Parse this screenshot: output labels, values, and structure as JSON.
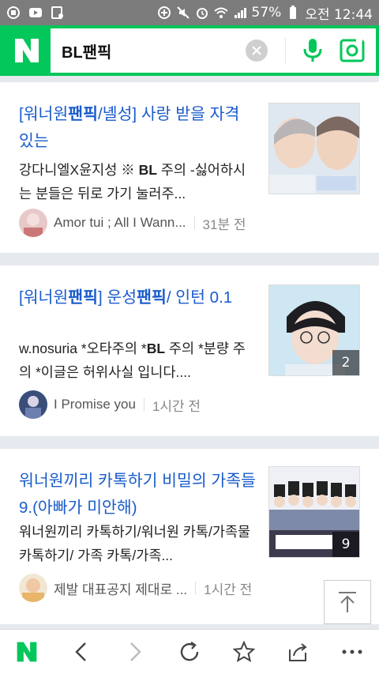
{
  "status_bar": {
    "battery": "57%",
    "time": "오전 12:44"
  },
  "search": {
    "query": "BL팬픽",
    "logo": "N"
  },
  "results": [
    {
      "title_parts": [
        {
          "text": "[워너원",
          "bold": false
        },
        {
          "text": "팬픽",
          "bold": true
        },
        {
          "text": "/녤성] 사랑 받을 자격 있는",
          "bold": false
        }
      ],
      "desc_parts": [
        {
          "text": "강다니엘X윤지성 ※ ",
          "bold": false
        },
        {
          "text": "BL",
          "bold": true
        },
        {
          "text": " 주의 -싫어하시는 분들은 뒤로 가기 눌러주...",
          "bold": false
        }
      ],
      "author": "Amor tui ; All I Wann...",
      "time": "31분 전",
      "image_count": ""
    },
    {
      "title_parts": [
        {
          "text": "[워너원",
          "bold": false
        },
        {
          "text": "팬픽",
          "bold": true
        },
        {
          "text": "] 운성",
          "bold": false
        },
        {
          "text": "팬픽",
          "bold": true
        },
        {
          "text": "/ 인턴 0.1",
          "bold": false
        }
      ],
      "desc_parts": [
        {
          "text": "w.nosuria *오타주의 *",
          "bold": false
        },
        {
          "text": "BL",
          "bold": true
        },
        {
          "text": " 주의 *분량 주의 *이글은 허위사실 입니다....",
          "bold": false
        }
      ],
      "author": "I Promise you",
      "time": "1시간 전",
      "image_count": "2"
    },
    {
      "title_parts": [
        {
          "text": "워너원끼리 카톡하기 비밀의 가족들 9.(아빠가 미안해)",
          "bold": false
        }
      ],
      "desc_parts": [
        {
          "text": "워너원끼리 카톡하기/워너원 카톡/가족물 카톡하기/ 가족 카톡/가족...",
          "bold": false
        }
      ],
      "author": "제발 대표공지 제대로 ...",
      "time": "1시간 전",
      "image_count": "9"
    }
  ],
  "colors": {
    "brand_green": "#03c75a",
    "title_blue": "#1a5ccc"
  },
  "bottom_nav": [
    "naver-home",
    "back",
    "forward",
    "refresh",
    "bookmark",
    "share",
    "more"
  ]
}
